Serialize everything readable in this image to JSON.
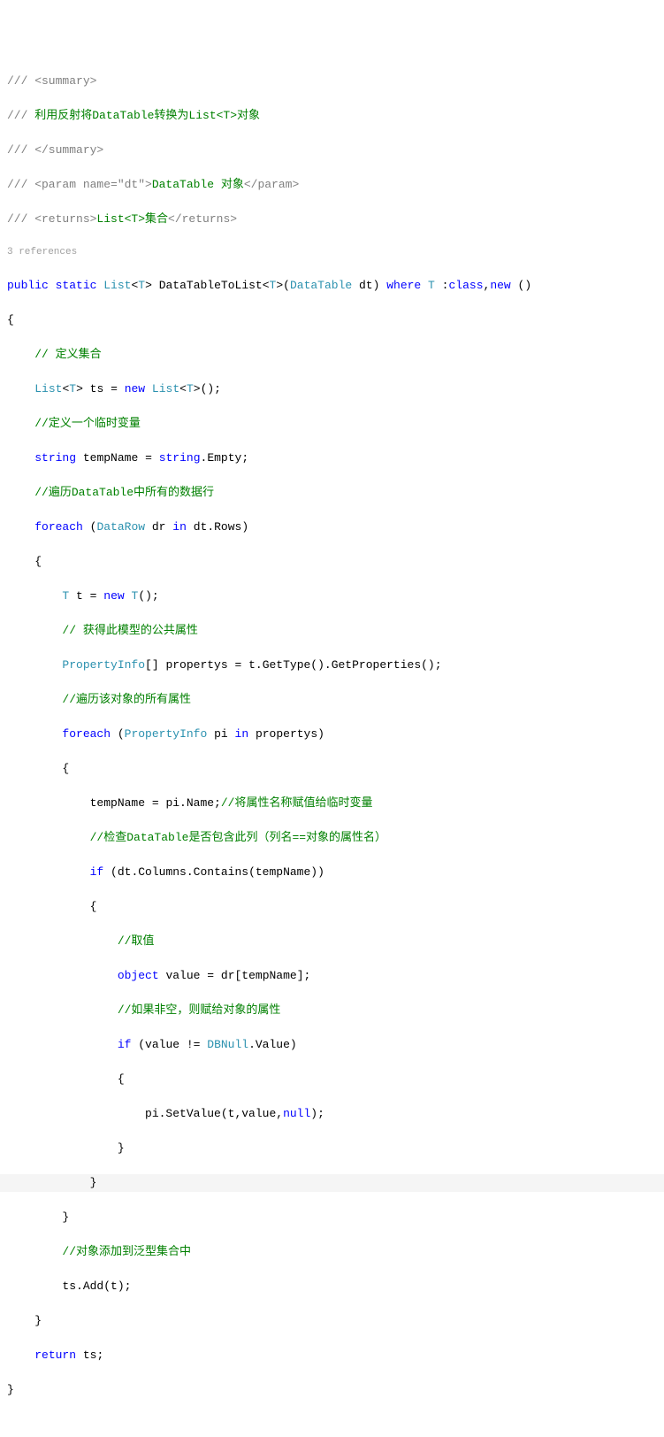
{
  "code": {
    "ref_count": "3 references",
    "xml_summary_open": "/// <summary>",
    "xml_summary_text": "/// 利用反射将DataTable转换为List<T>对象",
    "xml_summary_close": "/// </summary>",
    "xml_param": "/// <param name=\"dt\">DataTable 对象</param>",
    "xml_returns": "/// <returns>List<T>集合</returns>",
    "sig_public": "public",
    "sig_static": "static",
    "sig_list": "List",
    "sig_t1": "T",
    "sig_method": "DataTableToList",
    "sig_t2": "T",
    "sig_datatable": "DataTable",
    "sig_dt": "dt",
    "sig_where": "where",
    "sig_t3": "T",
    "sig_class": "class",
    "sig_new": "new",
    "comment_define_set": "// 定义集合",
    "decl_list": "List",
    "decl_t": "T",
    "decl_ts": "ts",
    "decl_new": "new",
    "decl_list2": "List",
    "decl_t2": "T",
    "comment_temp_var": "//定义一个临时变量",
    "decl_string": "string",
    "decl_tempname": "tempName",
    "decl_string2": "string",
    "decl_empty": "Empty",
    "comment_iterate": "//遍历DataTable中所有的数据行",
    "kw_foreach1": "foreach",
    "type_datarow": "DataRow",
    "var_dr": "dr",
    "kw_in1": "in",
    "var_dt_rows": "dt.Rows",
    "decl_t_var": "T",
    "var_t": "t",
    "kw_new2": "new",
    "type_t_ctor": "T",
    "comment_get_props": "// 获得此模型的公共属性",
    "type_propinfo": "PropertyInfo",
    "var_propertys": "propertys",
    "expr_gettype": "t.GetType().GetProperties();",
    "comment_iterate_props": "//遍历该对象的所有属性",
    "kw_foreach2": "foreach",
    "type_propinfo2": "PropertyInfo",
    "var_pi": "pi",
    "kw_in2": "in",
    "var_propertys2": "propertys",
    "assign_tempname": "tempName = pi.Name;",
    "comment_assign_name": "//将属性名称赋值给临时变量",
    "comment_check_col": "//检查DataTable是否包含此列（列名==对象的属性名）",
    "kw_if1": "if",
    "expr_contains": "(dt.Columns.Contains(tempName))",
    "comment_get_value": "//取值",
    "kw_object": "object",
    "var_value": "value",
    "expr_dr_index": "dr[tempName];",
    "comment_if_not_null": "//如果非空，则赋给对象的属性",
    "kw_if2": "if",
    "expr_value_ne": "(value != ",
    "type_dbnull": "DBNull",
    "expr_dbnull_value": ".Value)",
    "expr_setvalue": "pi.SetValue(t,value,",
    "kw_null": "null",
    "expr_setvalue_end": ");",
    "comment_add_to_list": "//对象添加到泛型集合中",
    "expr_ts_add": "ts.Add(t);",
    "kw_return": "return",
    "var_ts_ret": "ts;"
  }
}
